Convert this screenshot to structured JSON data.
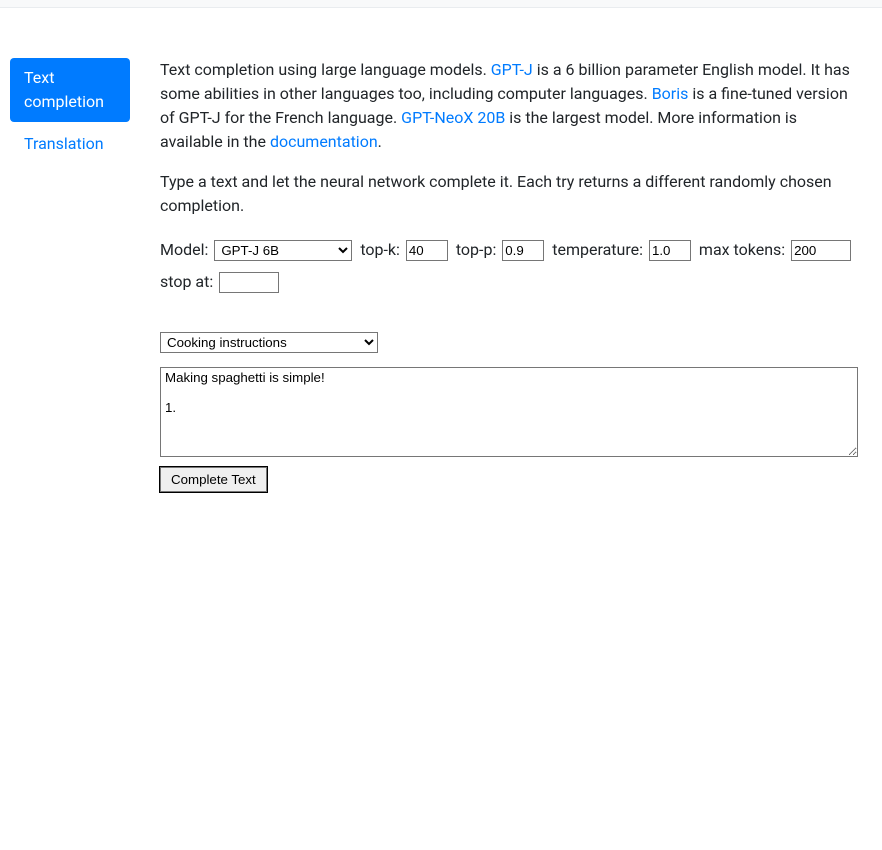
{
  "sidebar": {
    "items": [
      {
        "label": "Text completion",
        "active": true
      },
      {
        "label": "Translation",
        "active": false
      }
    ]
  },
  "description": {
    "part1": "Text completion using large language models. ",
    "link1": "GPT-J",
    "part2": " is a 6 billion parameter English model. It has some abilities in other languages too, including computer languages. ",
    "link2": "Boris",
    "part3": " is a fine-tuned version of GPT-J for the French language. ",
    "link3": "GPT-NeoX 20B",
    "part4": " is the largest model. More information is available in the ",
    "link4": "documentation",
    "part5": "."
  },
  "instructions": "Type a text and let the neural network complete it. Each try returns a different randomly chosen completion.",
  "params": {
    "model_label": "Model:",
    "model_value": "GPT-J 6B",
    "topk_label": "top-k:",
    "topk_value": "40",
    "topp_label": "top-p:",
    "topp_value": "0.9",
    "temperature_label": "temperature:",
    "temperature_value": "1.0",
    "maxtokens_label": "max tokens:",
    "maxtokens_value": "200",
    "stopat_label": "stop at:",
    "stopat_value": ""
  },
  "example": {
    "selected": "Cooking instructions"
  },
  "prompt": {
    "text": "Making spaghetti is simple!\n\n1."
  },
  "buttons": {
    "complete": "Complete Text"
  }
}
